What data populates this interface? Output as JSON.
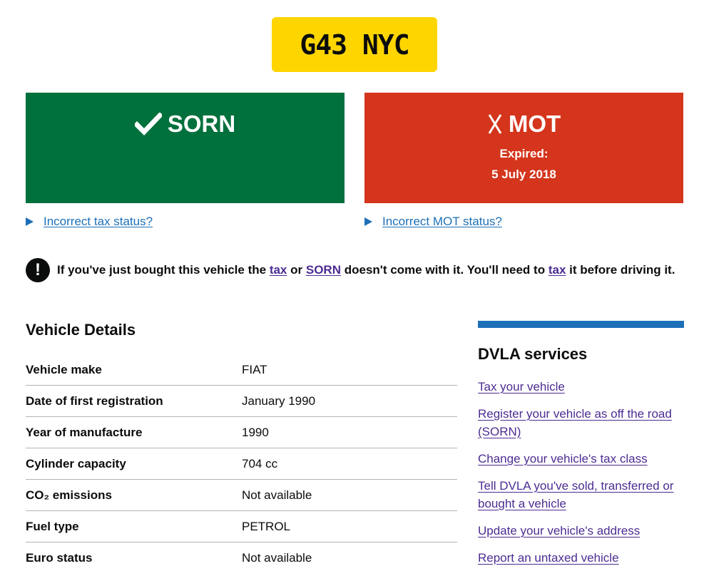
{
  "plate": "G43 NYC",
  "tax": {
    "status": "SORN",
    "icon": "check-icon",
    "link": "Incorrect tax status?"
  },
  "mot": {
    "status": "MOT",
    "icon": "cross-icon",
    "expired_label": "Expired:",
    "expired_date": "5 July 2018",
    "link": "Incorrect MOT status?"
  },
  "warning": {
    "part1": "If you've just bought this vehicle the",
    "link_tax": "tax",
    "or": "or",
    "link_sorn": "SORN",
    "part2": "doesn't come with it. You'll need to",
    "link_tax2": "tax",
    "part3": "it before driving it."
  },
  "details": {
    "title": "Vehicle Details",
    "rows": [
      {
        "label": "Vehicle make",
        "value": "FIAT"
      },
      {
        "label": "Date of first registration",
        "value": "January 1990"
      },
      {
        "label": "Year of manufacture",
        "value": "1990"
      },
      {
        "label": "Cylinder capacity",
        "value": "704 cc"
      },
      {
        "label": "CO₂ emissions",
        "value": "Not available"
      },
      {
        "label": "Fuel type",
        "value": "PETROL"
      },
      {
        "label": "Euro status",
        "value": "Not available"
      }
    ]
  },
  "services": {
    "title": "DVLA services",
    "links": [
      "Tax your vehicle",
      "Register your vehicle as off the road (SORN)",
      "Change your vehicle's tax class",
      "Tell DVLA you've sold, transferred or bought a vehicle",
      "Update your vehicle's address",
      "Report an untaxed vehicle"
    ]
  },
  "colors": {
    "green": "#00703c",
    "red": "#d4351c",
    "plate": "#ffd500",
    "link": "#1d70b8",
    "visited": "#4c2c92"
  }
}
